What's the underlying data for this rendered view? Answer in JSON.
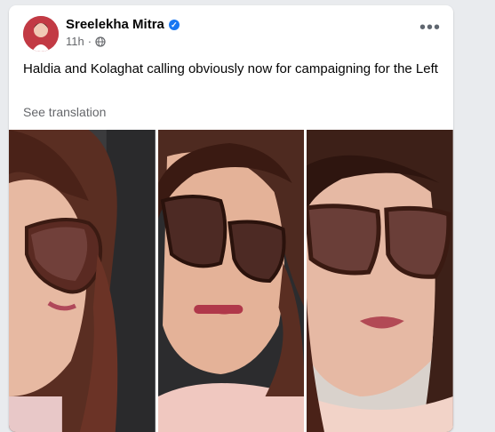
{
  "post": {
    "author": "Sreelekha Mitra",
    "time": "11h",
    "caption": "Haldia and Kolaghat calling obviously now for campaigning for the Left",
    "see_translation": "See translation"
  },
  "icons": {
    "verified": "verified-badge-icon",
    "audience": "globe-icon",
    "more": "more-options-icon"
  },
  "colors": {
    "link_blue": "#1877f2",
    "secondary_text": "#65676b",
    "card_bg": "#ffffff",
    "page_bg": "#e9ebee"
  }
}
